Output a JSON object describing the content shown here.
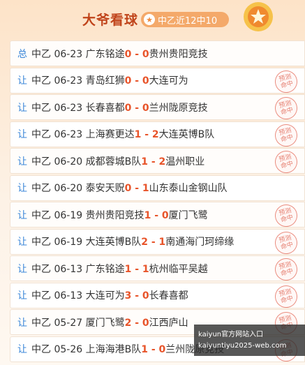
{
  "header": {
    "title": "大爷看球",
    "badge": "中乙近12中10",
    "badge_icon": "star-icon"
  },
  "stamp_text": [
    "预测",
    "命中"
  ],
  "rows": [
    {
      "tag": "总",
      "league": "中乙",
      "date": "06-23",
      "home": "广东铭途",
      "hs": "0",
      "as": "0",
      "away": "贵州贵阳竞技",
      "hit": false
    },
    {
      "tag": "让",
      "league": "中乙",
      "date": "06-23",
      "home": "青岛红狮",
      "hs": "0",
      "as": "0",
      "away": "大连可为",
      "hit": true
    },
    {
      "tag": "让",
      "league": "中乙",
      "date": "06-23",
      "home": "长春喜都",
      "hs": "0",
      "as": "0",
      "away": "兰州陇原竞技",
      "hit": true
    },
    {
      "tag": "让",
      "league": "中乙",
      "date": "06-23",
      "home": "上海赛更达",
      "hs": "1",
      "as": "2",
      "away": "大连英博B队",
      "hit": true
    },
    {
      "tag": "让",
      "league": "中乙",
      "date": "06-20",
      "home": "成都蓉城B队",
      "hs": "1",
      "as": "2",
      "away": "温州职业",
      "hit": true
    },
    {
      "tag": "让",
      "league": "中乙",
      "date": "06-20",
      "home": "泰安天贶",
      "hs": "0",
      "as": "1",
      "away": "山东泰山金钢山队",
      "hit": false
    },
    {
      "tag": "让",
      "league": "中乙",
      "date": "06-19",
      "home": "贵州贵阳竞技",
      "hs": "1",
      "as": "0",
      "away": "厦门飞鹭",
      "hit": true
    },
    {
      "tag": "让",
      "league": "中乙",
      "date": "06-19",
      "home": "大连英博B队",
      "hs": "2",
      "as": "1",
      "away": "南通海门珂缔缘",
      "hit": true
    },
    {
      "tag": "让",
      "league": "中乙",
      "date": "06-13",
      "home": "广东铭途",
      "hs": "1",
      "as": "1",
      "away": "杭州临平吴越",
      "hit": true
    },
    {
      "tag": "让",
      "league": "中乙",
      "date": "06-13",
      "home": "大连可为",
      "hs": "3",
      "as": "0",
      "away": "长春喜都",
      "hit": true
    },
    {
      "tag": "让",
      "league": "中乙",
      "date": "05-27",
      "home": "厦门飞鹭",
      "hs": "2",
      "as": "0",
      "away": "江西庐山",
      "hit": true
    },
    {
      "tag": "让",
      "league": "中乙",
      "date": "05-26",
      "home": "上海海港B队",
      "hs": "1",
      "as": "0",
      "away": "兰州陇原竞技",
      "hit": true
    }
  ],
  "overlay": {
    "line1": "kaiyun官方网站入口",
    "line2": "kaiyuntiyu2025-web.com"
  }
}
